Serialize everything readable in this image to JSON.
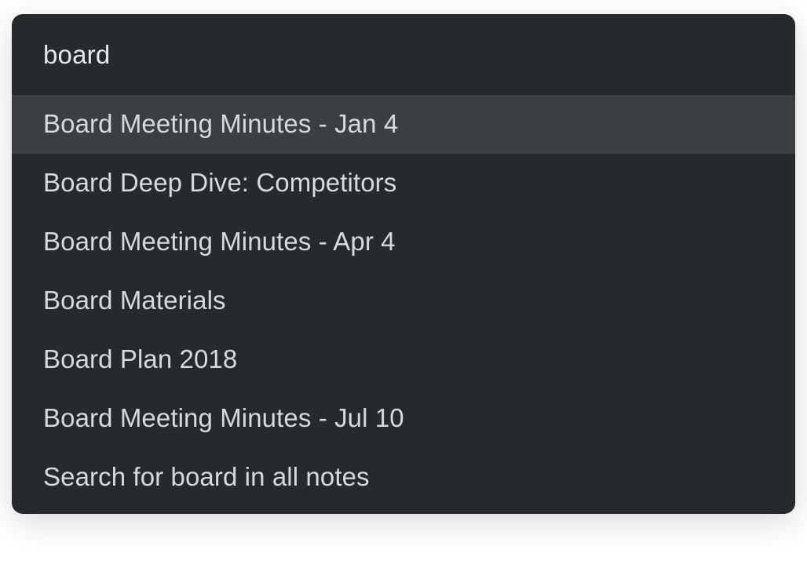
{
  "search": {
    "query": "board"
  },
  "results": [
    {
      "label": "Board Meeting Minutes - Jan 4",
      "highlighted": true
    },
    {
      "label": "Board Deep Dive: Competitors",
      "highlighted": false
    },
    {
      "label": "Board Meeting Minutes - Apr 4",
      "highlighted": false
    },
    {
      "label": "Board Materials",
      "highlighted": false
    },
    {
      "label": "Board Plan 2018",
      "highlighted": false
    },
    {
      "label": "Board Meeting Minutes - Jul 10",
      "highlighted": false
    },
    {
      "label": "Search for board in all notes",
      "highlighted": false
    }
  ]
}
